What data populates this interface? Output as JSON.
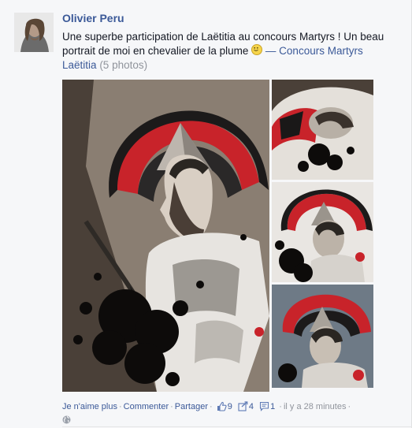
{
  "post": {
    "author": "Olivier Peru",
    "message_text": "Une superbe participation de Laëtitia au concours Martyrs ! Un beau portrait de moi en chevalier de la plume",
    "album_link": "— Concours Martyrs Laëtitia",
    "photo_count": "(5 photos)"
  },
  "actions": {
    "unlike": "Je n'aime plus",
    "comment": "Commenter",
    "share": "Partager",
    "likes_count": "9",
    "shares_count": "4",
    "comments_count": "1",
    "timestamp": "il y a 28 minutes"
  },
  "colors": {
    "link_blue": "#3b5998",
    "muted_gray": "#90949c",
    "artwork_red": "#c8232a"
  },
  "icons": [
    "thumbs-up-icon",
    "share-icon",
    "comment-icon",
    "globe-icon",
    "smiley-icon"
  ]
}
